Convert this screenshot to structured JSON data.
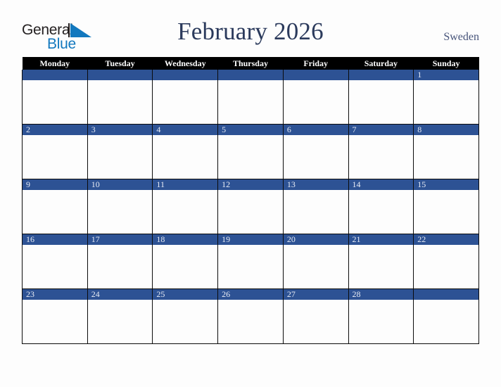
{
  "brand": {
    "name_top": "General",
    "name_bottom": "Blue",
    "triangle_icon": "blue-triangle-icon",
    "color_dark": "#231f20",
    "color_blue": "#1278be"
  },
  "header": {
    "title": "February 2026",
    "country": "Sweden",
    "title_color": "#2b3a5c",
    "country_color": "#47547a"
  },
  "calendar": {
    "weekdays": [
      "Monday",
      "Tuesday",
      "Wednesday",
      "Thursday",
      "Friday",
      "Saturday",
      "Sunday"
    ],
    "header_bg": "#000000",
    "header_text_color": "#ffffff",
    "daynum_bg": "#2d5294",
    "daynum_text_color": "#e8ecf5",
    "cell_bg": "#fdfdfd",
    "grid_line_color": "#0b0b0b",
    "weeks": [
      [
        "",
        "",
        "",
        "",
        "",
        "",
        "1"
      ],
      [
        "2",
        "3",
        "4",
        "5",
        "6",
        "7",
        "8"
      ],
      [
        "9",
        "10",
        "11",
        "12",
        "13",
        "14",
        "15"
      ],
      [
        "16",
        "17",
        "18",
        "19",
        "20",
        "21",
        "22"
      ],
      [
        "23",
        "24",
        "25",
        "26",
        "27",
        "28",
        ""
      ]
    ]
  }
}
